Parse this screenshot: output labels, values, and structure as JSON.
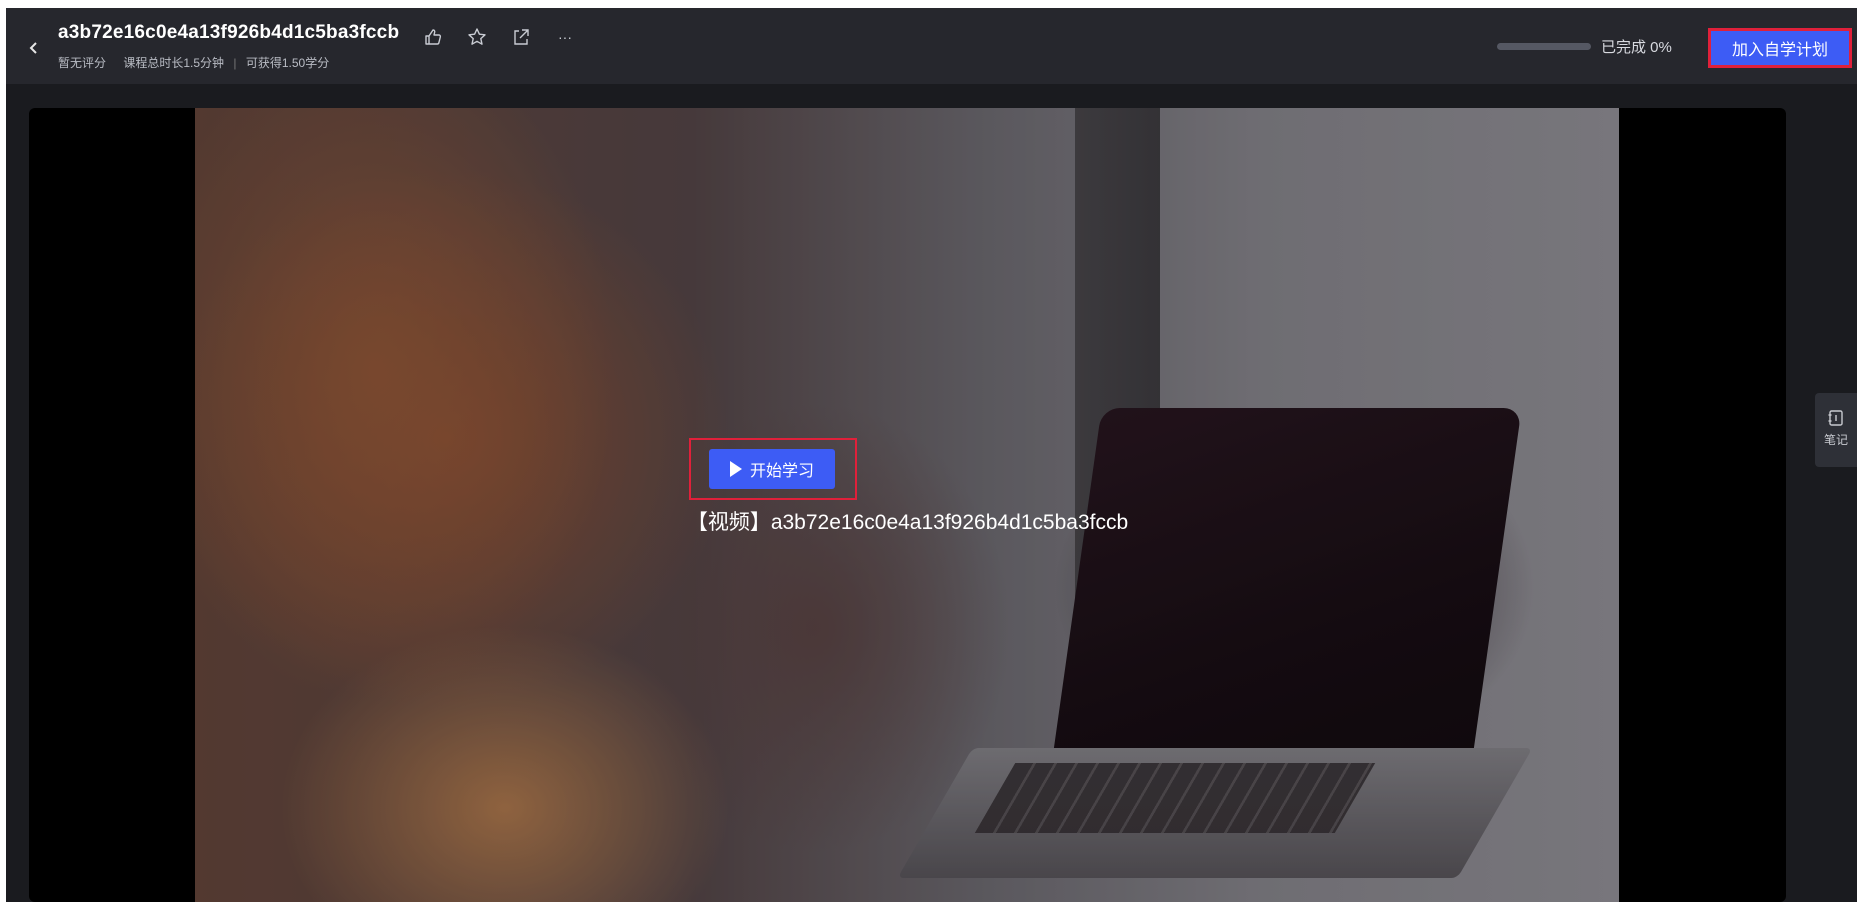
{
  "header": {
    "back_icon": "chevron-left-icon",
    "title": "a3b72e16c0e4a13f926b4d1c5ba3fccb",
    "rating": "暂无评分",
    "duration": "课程总时长1.5分钟",
    "separator": "|",
    "credits": "可获得1.50学分",
    "actions": [
      "thumbs-up-icon",
      "star-icon",
      "share-icon",
      "more-icon"
    ],
    "more_label": "···",
    "progress_value": 0,
    "progress_text": "已完成 0%",
    "join_button": "加入自学计划"
  },
  "player": {
    "center_title": "【视频】a3b72e16c0e4a13f926b4d1c5ba3fccb",
    "start_button": "开始学习"
  },
  "side": {
    "notes_label": "笔记"
  },
  "colors": {
    "accent": "#3d5cf5",
    "highlight_outline": "#e0203a",
    "header_bg": "#26272d",
    "page_bg": "#1a1b1f"
  }
}
